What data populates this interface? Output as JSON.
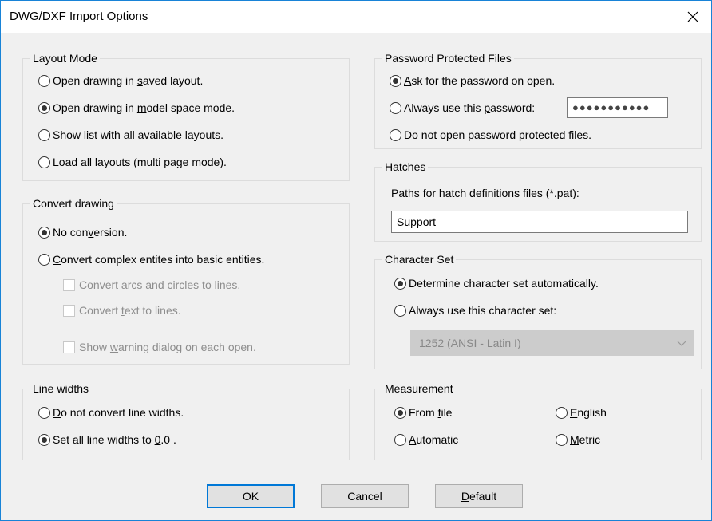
{
  "window": {
    "title": "DWG/DXF Import Options",
    "close_glyph": "✕"
  },
  "layout_mode": {
    "title": "Layout Mode",
    "options": [
      {
        "pre": "Open drawing in ",
        "key": "s",
        "post": "aved layout.",
        "checked": false
      },
      {
        "pre": "Open drawing in ",
        "key": "m",
        "post": "odel space mode.",
        "checked": true
      },
      {
        "pre": "Show ",
        "key": "l",
        "post": "ist with all available layouts.",
        "checked": false
      },
      {
        "pre": "Load all layouts (multi page mode).",
        "key": "",
        "post": "",
        "checked": false
      }
    ]
  },
  "convert_drawing": {
    "title": "Convert drawing",
    "options": [
      {
        "pre": "No con",
        "key": "v",
        "post": "ersion.",
        "checked": true
      },
      {
        "pre": "",
        "key": "C",
        "post": "onvert complex entites into basic entities.",
        "checked": false
      }
    ],
    "checkboxes": [
      {
        "pre": "Con",
        "key": "v",
        "post": "ert arcs and circles to lines.",
        "checked": false
      },
      {
        "pre": "Convert ",
        "key": "t",
        "post": "ext to lines.",
        "checked": false
      },
      {
        "pre": "Show ",
        "key": "w",
        "post": "arning dialog on each open.",
        "checked": false
      }
    ]
  },
  "line_widths": {
    "title": "Line widths",
    "options": [
      {
        "pre": "",
        "key": "D",
        "post": "o not convert line widths.",
        "checked": false
      },
      {
        "pre": "Set all line widths to ",
        "key": "0",
        "post": ".0 .",
        "checked": true
      }
    ]
  },
  "password": {
    "title": "Password Protected Files",
    "options": [
      {
        "pre": "",
        "key": "A",
        "post": "sk for the password on open.",
        "checked": true
      },
      {
        "pre": "Always use this ",
        "key": "p",
        "post": "assword:",
        "checked": false
      },
      {
        "pre": "Do ",
        "key": "n",
        "post": "ot open password protected files.",
        "checked": false
      }
    ],
    "password_value": "●●●●●●●●●●●"
  },
  "hatches": {
    "title": "Hatches",
    "label": "Paths for hatch definitions files (*.pat):",
    "value": "Support"
  },
  "charset": {
    "title": "Character Set",
    "options": [
      {
        "pre": "Determine character set automatically.",
        "key": "",
        "post": "",
        "checked": true
      },
      {
        "pre": "Always use this character set:",
        "key": "",
        "post": "",
        "checked": false
      }
    ],
    "selected": "1252  (ANSI - Latin I)",
    "arrow_glyph": "⌵"
  },
  "measurement": {
    "title": "Measurement",
    "options": [
      {
        "pre": "From ",
        "key": "f",
        "post": "ile",
        "checked": true
      },
      {
        "pre": "",
        "key": "E",
        "post": "nglish",
        "checked": false
      },
      {
        "pre": "",
        "key": "A",
        "post": "utomatic",
        "checked": false
      },
      {
        "pre": "",
        "key": "M",
        "post": "etric",
        "checked": false
      }
    ]
  },
  "buttons": {
    "ok": {
      "pre": "OK",
      "key": "",
      "post": ""
    },
    "cancel": {
      "pre": "Cancel",
      "key": "",
      "post": ""
    },
    "default": {
      "pre": "",
      "key": "D",
      "post": "efault"
    }
  },
  "colors": {
    "accent": "#0078d7",
    "window_border": "#1883d7",
    "dialog_bg": "#f0f0f0",
    "disabled_text": "#8d8d8d"
  },
  "icons": {
    "close": "close-icon",
    "dropdown": "chevron-down-icon"
  }
}
